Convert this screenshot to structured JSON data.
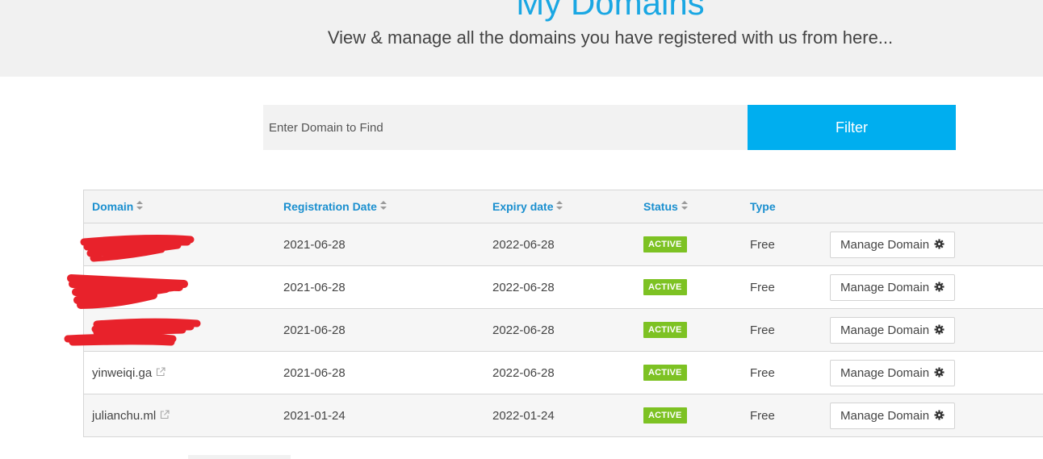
{
  "hero": {
    "title": "My Domains",
    "subtitle": "View & manage all the domains you have registered with us from here..."
  },
  "filter": {
    "placeholder": "Enter Domain to Find",
    "button_label": "Filter"
  },
  "table": {
    "columns": [
      "Domain",
      "Registration Date",
      "Expiry date",
      "Status",
      "Type"
    ],
    "sortable_icon": "sort-icon",
    "rows": [
      {
        "domain": "",
        "redacted": true,
        "registration_date": "2021-06-28",
        "expiry_date": "2022-06-28",
        "status": "ACTIVE",
        "type": "Free",
        "action": "Manage Domain"
      },
      {
        "domain": "",
        "redacted": true,
        "registration_date": "2021-06-28",
        "expiry_date": "2022-06-28",
        "status": "ACTIVE",
        "type": "Free",
        "action": "Manage Domain"
      },
      {
        "domain": "",
        "redacted": true,
        "registration_date": "2021-06-28",
        "expiry_date": "2022-06-28",
        "status": "ACTIVE",
        "type": "Free",
        "action": "Manage Domain"
      },
      {
        "domain": "yinweiqi.ga",
        "redacted": false,
        "registration_date": "2021-06-28",
        "expiry_date": "2022-06-28",
        "status": "ACTIVE",
        "type": "Free",
        "action": "Manage Domain"
      },
      {
        "domain": "julianchu.ml",
        "redacted": false,
        "registration_date": "2021-01-24",
        "expiry_date": "2022-01-24",
        "status": "ACTIVE",
        "type": "Free",
        "action": "Manage Domain"
      }
    ]
  },
  "colors": {
    "accent": "#00aeef",
    "heading_link": "#1a8fcf",
    "status_active": "#7dc223",
    "redaction": "#e8222b"
  },
  "icons": {
    "external_link": "external-link-icon",
    "gear": "gear-icon",
    "sort": "sort-icon"
  }
}
